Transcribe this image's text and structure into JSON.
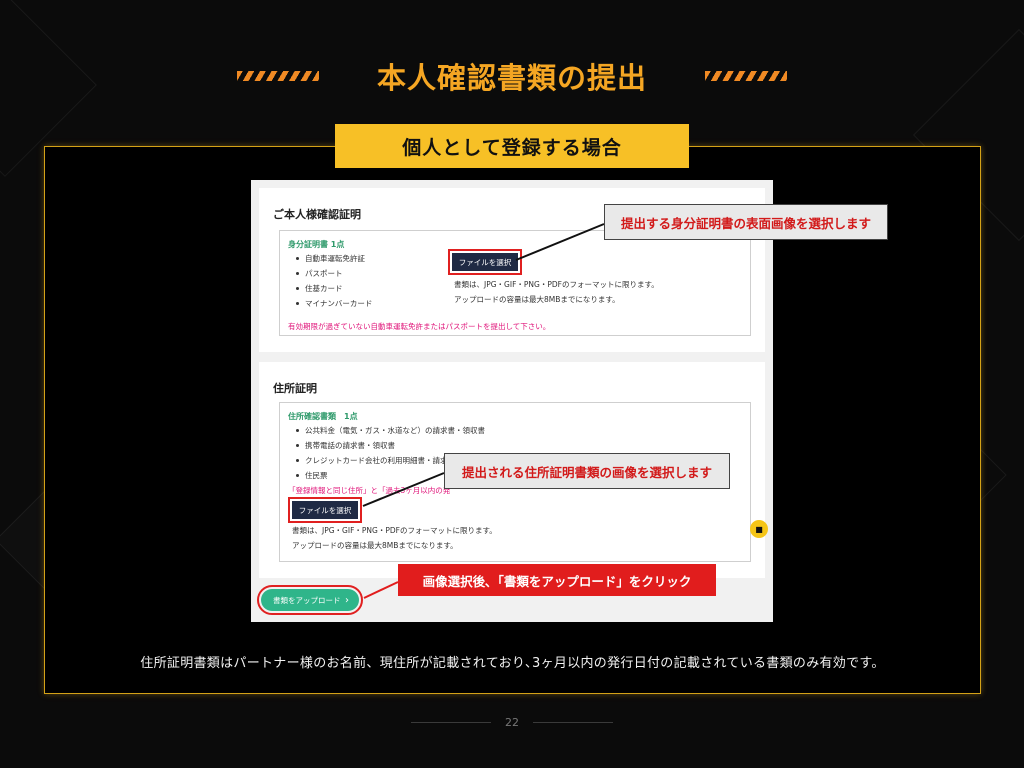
{
  "header": {
    "title": "本人確認書類の提出",
    "subtitle": "個人として登録する場合"
  },
  "identity": {
    "title": "ご本人様確認証明",
    "category": "身分証明書 1点",
    "items": [
      "自動車運転免許証",
      "パスポート",
      "住基カード",
      "マイナンバーカード"
    ],
    "warning": "有効期限が過ぎていない自動車運転免許またはパスポートを提出して下さい。",
    "file_button": "ファイルを選択",
    "note1": "書類は、JPG・GIF・PNG・PDFのフォーマットに限ります。",
    "note2": "アップロードの容量は最大8MBまでになります。"
  },
  "address": {
    "title": "住所証明",
    "category": "住所確認書類　1点",
    "items": [
      "公共料金（電気・ガス・水道など）の請求書・領収書",
      "携帯電話の請求書・領収書",
      "クレジットカード会社の利用明細書・請求書",
      "住民票"
    ],
    "warning": "「登録情報と同じ住所」と「過去3ヶ月以内の発",
    "file_button": "ファイルを選択",
    "note1": "書類は、JPG・GIF・PNG・PDFのフォーマットに限ります。",
    "note2": "アップロードの容量は最大8MBまでになります。"
  },
  "upload_button": "書類をアップロード",
  "callouts": {
    "c1": "提出する身分証明書の表面画像を選択します",
    "c2": "提出される住所証明書類の画像を選択します",
    "c3": "画像選択後､「書類をアップロード」をクリック"
  },
  "footer": "住所証明書類はパートナー様のお名前、現住所が記載されており､3ヶ月以内の発行日付の記載されている書類のみ有効です。",
  "page_number": "22",
  "colors": {
    "title": "#f5a623",
    "subtitle_bg": "#f7c026",
    "callout_text": "#d21a1a",
    "upload_button": "#2fb58a",
    "warning": "#e0157a"
  }
}
